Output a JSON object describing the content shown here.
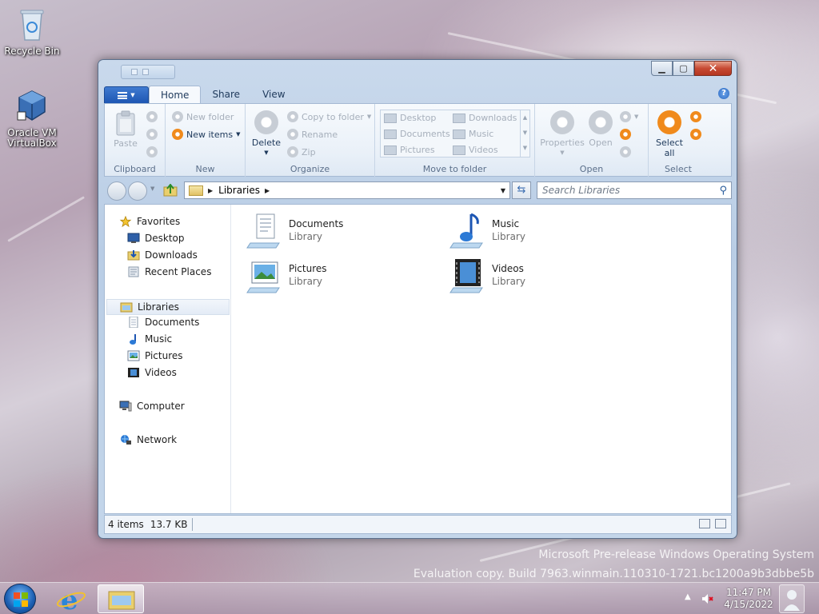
{
  "desktop": {
    "icons": [
      {
        "label": "Recycle Bin"
      },
      {
        "label": "Oracle VM VirtualBox"
      }
    ],
    "watermark": {
      "line1": "Microsoft Pre-release Windows Operating System",
      "line2": "Evaluation copy. Build 7963.winmain.110310-1721.bc1200a9b3dbbe5b"
    }
  },
  "window": {
    "ribbon_tabs": {
      "home": "Home",
      "share": "Share",
      "view": "View"
    },
    "help_label": "?",
    "clipboard": {
      "paste": "Paste",
      "group": "Clipboard"
    },
    "new_group": {
      "new_folder": "New folder",
      "new_items": "New items",
      "group": "New"
    },
    "organize": {
      "delete": "Delete",
      "copy_to_folder": "Copy to folder",
      "rename": "Rename",
      "zip": "Zip",
      "group": "Organize"
    },
    "move_to": {
      "items": [
        "Desktop",
        "Downloads",
        "Documents",
        "Music",
        "Pictures",
        "Videos"
      ],
      "group": "Move to folder"
    },
    "open_group": {
      "properties": "Properties",
      "open": "Open",
      "group": "Open"
    },
    "select_group": {
      "select_all_line1": "Select",
      "select_all_line2": "all",
      "group": "Select"
    },
    "address": {
      "path": "Libraries"
    },
    "search": {
      "placeholder": "Search Libraries"
    },
    "nav": {
      "favorites": "Favorites",
      "desktop": "Desktop",
      "downloads": "Downloads",
      "recent_places": "Recent Places",
      "libraries": "Libraries",
      "documents": "Documents",
      "music": "Music",
      "pictures": "Pictures",
      "videos": "Videos",
      "computer": "Computer",
      "network": "Network"
    },
    "libraries": [
      {
        "name": "Documents",
        "type": "Library"
      },
      {
        "name": "Music",
        "type": "Library"
      },
      {
        "name": "Pictures",
        "type": "Library"
      },
      {
        "name": "Videos",
        "type": "Library"
      }
    ],
    "status": {
      "count": "4 items",
      "size": "13.7 KB"
    }
  },
  "taskbar": {
    "time": "11:47 PM",
    "date": "4/15/2022"
  },
  "colors": {
    "accent_orange": "#f08a1c",
    "file_tab_blue": "#1d56b3"
  }
}
